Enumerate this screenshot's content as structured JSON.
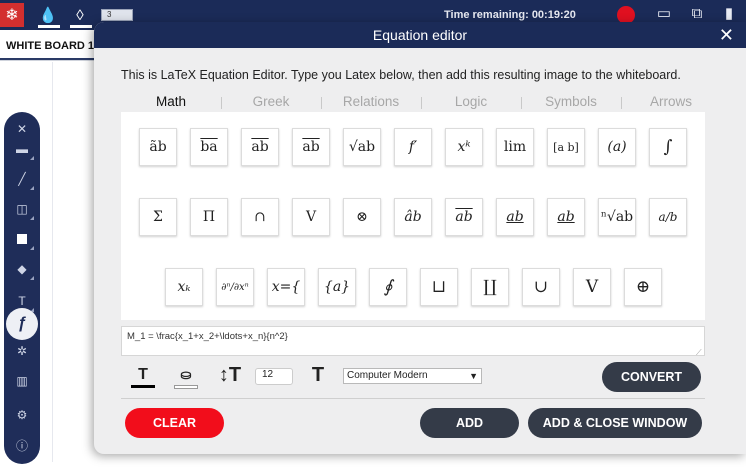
{
  "topbar": {
    "page_label": "3",
    "time_remaining": "Time remaining: 00:19:20",
    "icons": [
      "snowflake-icon",
      "water-drop-icon",
      "water-drop-outline-icon",
      "record-icon",
      "monitor-icon",
      "window-icon",
      "chart-icon"
    ]
  },
  "board_tab": "WHITE BOARD 1",
  "toolbar": {
    "tools": [
      "close-icon",
      "brush-icon",
      "line-icon",
      "shape-icon",
      "fill-icon",
      "eraser-icon",
      "text-icon",
      "formula-icon",
      "gear-icon",
      "trash-icon",
      "settings-icon",
      "info-icon"
    ]
  },
  "dialog": {
    "title": "Equation editor",
    "close_glyph": "✕",
    "description": "This is LaTeX Equation Editor. Type you Latex below, then add this resulting image to the whiteboard.",
    "tabs": [
      "Math",
      "Greek",
      "Relations",
      "Logic",
      "Symbols",
      "Arrows"
    ],
    "active_tab": "Math",
    "symbols_row1": [
      "ãb",
      "ba",
      "ab",
      "ab",
      "√ab",
      "f′",
      "xᵏ",
      "lim",
      "[a b]",
      "(a)",
      "∫"
    ],
    "symbols_row2": [
      "Σ",
      "Π",
      "∩",
      "V",
      "⊗",
      "âb",
      "ab",
      "ab",
      "ab",
      "ⁿ√ab",
      "a/b"
    ],
    "symbols_row3": [
      "xₖ",
      "∂ⁿ/∂xⁿ",
      "x={",
      "{a}",
      "∮",
      "⊔",
      "∐",
      "∪",
      "V",
      "⊕"
    ],
    "latex_input": "M_1 = \\frac{x_1+x_2+\\ldots+x_n}{n^2}",
    "text_color_glyph": "T",
    "text_color": "#000000",
    "fill_color": "#ffffff",
    "font_size": "12",
    "font_family": "Computer Modern",
    "buttons": {
      "convert": "CONVERT",
      "clear": "CLEAR",
      "add": "ADD",
      "add_close": "ADD & CLOSE WINDOW"
    }
  }
}
